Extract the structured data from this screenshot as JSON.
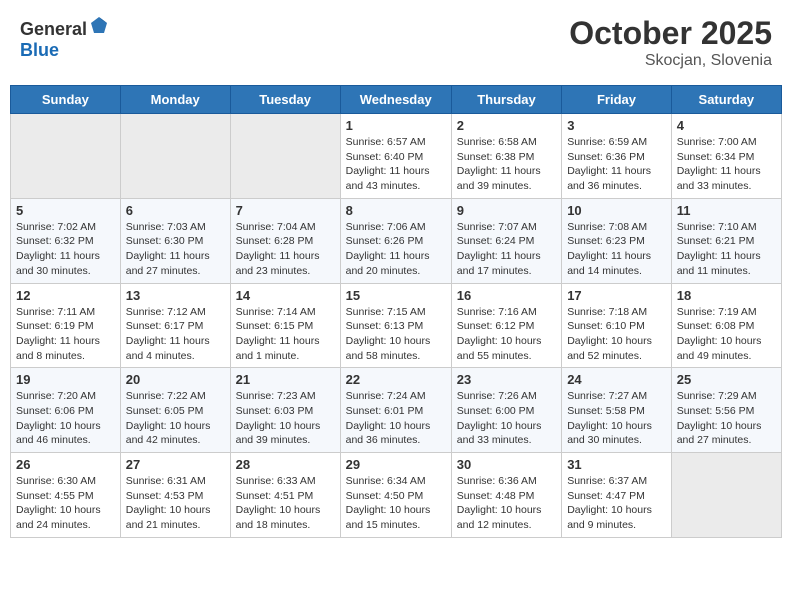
{
  "header": {
    "logo_general": "General",
    "logo_blue": "Blue",
    "month": "October 2025",
    "location": "Skocjan, Slovenia"
  },
  "weekdays": [
    "Sunday",
    "Monday",
    "Tuesday",
    "Wednesday",
    "Thursday",
    "Friday",
    "Saturday"
  ],
  "weeks": [
    [
      {
        "num": "",
        "info": ""
      },
      {
        "num": "",
        "info": ""
      },
      {
        "num": "",
        "info": ""
      },
      {
        "num": "1",
        "info": "Sunrise: 6:57 AM\nSunset: 6:40 PM\nDaylight: 11 hours\nand 43 minutes."
      },
      {
        "num": "2",
        "info": "Sunrise: 6:58 AM\nSunset: 6:38 PM\nDaylight: 11 hours\nand 39 minutes."
      },
      {
        "num": "3",
        "info": "Sunrise: 6:59 AM\nSunset: 6:36 PM\nDaylight: 11 hours\nand 36 minutes."
      },
      {
        "num": "4",
        "info": "Sunrise: 7:00 AM\nSunset: 6:34 PM\nDaylight: 11 hours\nand 33 minutes."
      }
    ],
    [
      {
        "num": "5",
        "info": "Sunrise: 7:02 AM\nSunset: 6:32 PM\nDaylight: 11 hours\nand 30 minutes."
      },
      {
        "num": "6",
        "info": "Sunrise: 7:03 AM\nSunset: 6:30 PM\nDaylight: 11 hours\nand 27 minutes."
      },
      {
        "num": "7",
        "info": "Sunrise: 7:04 AM\nSunset: 6:28 PM\nDaylight: 11 hours\nand 23 minutes."
      },
      {
        "num": "8",
        "info": "Sunrise: 7:06 AM\nSunset: 6:26 PM\nDaylight: 11 hours\nand 20 minutes."
      },
      {
        "num": "9",
        "info": "Sunrise: 7:07 AM\nSunset: 6:24 PM\nDaylight: 11 hours\nand 17 minutes."
      },
      {
        "num": "10",
        "info": "Sunrise: 7:08 AM\nSunset: 6:23 PM\nDaylight: 11 hours\nand 14 minutes."
      },
      {
        "num": "11",
        "info": "Sunrise: 7:10 AM\nSunset: 6:21 PM\nDaylight: 11 hours\nand 11 minutes."
      }
    ],
    [
      {
        "num": "12",
        "info": "Sunrise: 7:11 AM\nSunset: 6:19 PM\nDaylight: 11 hours\nand 8 minutes."
      },
      {
        "num": "13",
        "info": "Sunrise: 7:12 AM\nSunset: 6:17 PM\nDaylight: 11 hours\nand 4 minutes."
      },
      {
        "num": "14",
        "info": "Sunrise: 7:14 AM\nSunset: 6:15 PM\nDaylight: 11 hours\nand 1 minute."
      },
      {
        "num": "15",
        "info": "Sunrise: 7:15 AM\nSunset: 6:13 PM\nDaylight: 10 hours\nand 58 minutes."
      },
      {
        "num": "16",
        "info": "Sunrise: 7:16 AM\nSunset: 6:12 PM\nDaylight: 10 hours\nand 55 minutes."
      },
      {
        "num": "17",
        "info": "Sunrise: 7:18 AM\nSunset: 6:10 PM\nDaylight: 10 hours\nand 52 minutes."
      },
      {
        "num": "18",
        "info": "Sunrise: 7:19 AM\nSunset: 6:08 PM\nDaylight: 10 hours\nand 49 minutes."
      }
    ],
    [
      {
        "num": "19",
        "info": "Sunrise: 7:20 AM\nSunset: 6:06 PM\nDaylight: 10 hours\nand 46 minutes."
      },
      {
        "num": "20",
        "info": "Sunrise: 7:22 AM\nSunset: 6:05 PM\nDaylight: 10 hours\nand 42 minutes."
      },
      {
        "num": "21",
        "info": "Sunrise: 7:23 AM\nSunset: 6:03 PM\nDaylight: 10 hours\nand 39 minutes."
      },
      {
        "num": "22",
        "info": "Sunrise: 7:24 AM\nSunset: 6:01 PM\nDaylight: 10 hours\nand 36 minutes."
      },
      {
        "num": "23",
        "info": "Sunrise: 7:26 AM\nSunset: 6:00 PM\nDaylight: 10 hours\nand 33 minutes."
      },
      {
        "num": "24",
        "info": "Sunrise: 7:27 AM\nSunset: 5:58 PM\nDaylight: 10 hours\nand 30 minutes."
      },
      {
        "num": "25",
        "info": "Sunrise: 7:29 AM\nSunset: 5:56 PM\nDaylight: 10 hours\nand 27 minutes."
      }
    ],
    [
      {
        "num": "26",
        "info": "Sunrise: 6:30 AM\nSunset: 4:55 PM\nDaylight: 10 hours\nand 24 minutes."
      },
      {
        "num": "27",
        "info": "Sunrise: 6:31 AM\nSunset: 4:53 PM\nDaylight: 10 hours\nand 21 minutes."
      },
      {
        "num": "28",
        "info": "Sunrise: 6:33 AM\nSunset: 4:51 PM\nDaylight: 10 hours\nand 18 minutes."
      },
      {
        "num": "29",
        "info": "Sunrise: 6:34 AM\nSunset: 4:50 PM\nDaylight: 10 hours\nand 15 minutes."
      },
      {
        "num": "30",
        "info": "Sunrise: 6:36 AM\nSunset: 4:48 PM\nDaylight: 10 hours\nand 12 minutes."
      },
      {
        "num": "31",
        "info": "Sunrise: 6:37 AM\nSunset: 4:47 PM\nDaylight: 10 hours\nand 9 minutes."
      },
      {
        "num": "",
        "info": ""
      }
    ]
  ]
}
